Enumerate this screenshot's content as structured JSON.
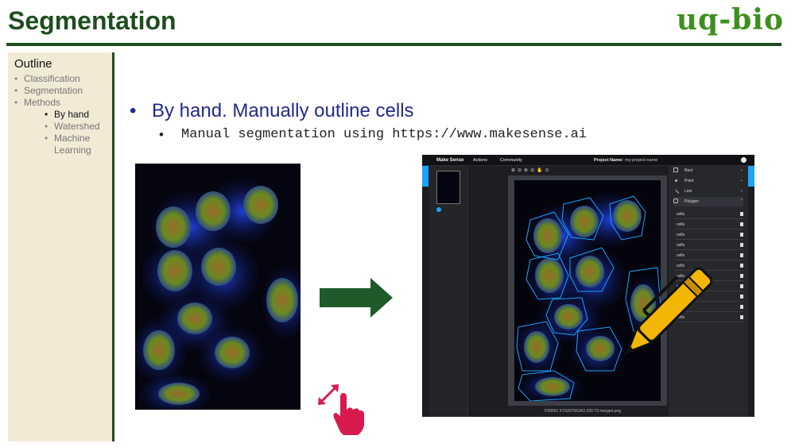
{
  "header": {
    "title": "Segmentation",
    "brand": "uq-bio"
  },
  "outline": {
    "title": "Outline",
    "items": [
      {
        "label": "Classification",
        "level": 1,
        "active": false
      },
      {
        "label": "Segmentation",
        "level": 1,
        "active": false
      },
      {
        "label": "Methods",
        "level": 1,
        "active": false
      },
      {
        "label": "By hand",
        "level": 2,
        "active": true
      },
      {
        "label": "Watershed",
        "level": 2,
        "active": false
      },
      {
        "label": "Machine Learning",
        "level": 2,
        "active": false
      }
    ]
  },
  "content": {
    "bullet_main": "By hand. Manually outline cells",
    "bullet_sub": "Manual segmentation using https://www.makesense.ai"
  },
  "app": {
    "logo": "Make Sense",
    "actions": "Actions",
    "community": "Community",
    "project_label": "Project Name:",
    "project_value": "my-project-name",
    "tools": [
      "Rect",
      "Point",
      "Line",
      "Polygon"
    ],
    "labels": [
      "cells",
      "cells",
      "cells",
      "cells",
      "cells",
      "cells",
      "cells",
      "cells",
      "cells",
      "cells",
      "cells"
    ],
    "filename": "P00001 KY9207552A3 Z00 T0 merged.png"
  },
  "colors": {
    "title": "#1e4d1e",
    "brand": "#3f8f1f",
    "bullet_main": "#1f2a8c",
    "arrow": "#1e5a2a",
    "hand": "#d81b4f",
    "polygon": "#1aa3ff",
    "pen": "#f2b705"
  },
  "icons": {
    "arrow": "right-arrow-icon",
    "hand": "pinch-hand-icon",
    "pen": "pen-icon"
  }
}
